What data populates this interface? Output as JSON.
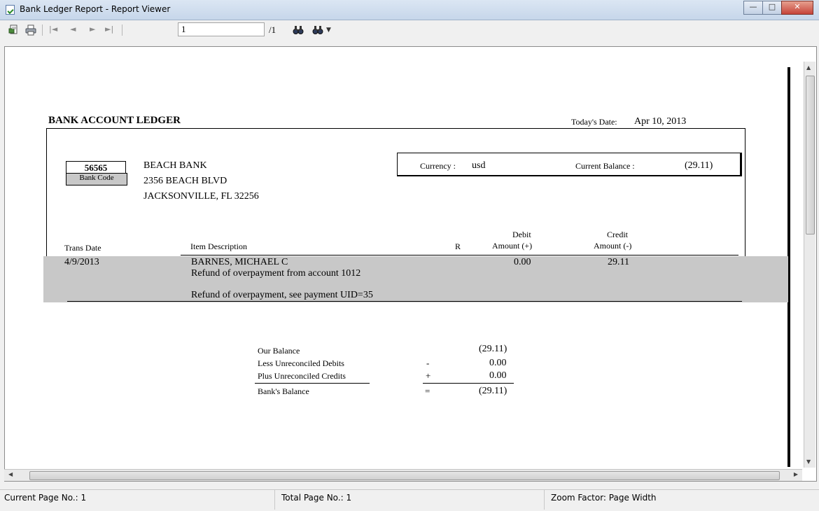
{
  "window": {
    "title": "Bank Ledger Report - Report Viewer"
  },
  "toolbar": {
    "page_value": "1",
    "page_total": "/1"
  },
  "report": {
    "heading": "BANK ACCOUNT LEDGER",
    "todays_date_label": "Today's Date:",
    "todays_date_value": "Apr 10, 2013",
    "bank_code_value": "56565",
    "bank_code_label": "Bank Code",
    "bank_name": "BEACH BANK",
    "bank_address1": "2356 BEACH BLVD",
    "bank_address2": "JACKSONVILLE, FL 32256",
    "currency_label": "Currency :",
    "currency_value": "usd",
    "current_balance_label": "Current Balance :",
    "current_balance_value": "(29.11)",
    "columns": {
      "trans_date": "Trans Date",
      "item_description": "Item Description",
      "r": "R",
      "debit_line1": "Debit",
      "debit_line2": "Amount (+)",
      "credit_line1": "Credit",
      "credit_line2": "Amount (-)"
    },
    "rows": [
      {
        "date": "4/9/2013",
        "name": "BARNES, MICHAEL C",
        "desc1": "Refund of overpayment from account 1012",
        "desc2": "Refund of overpayment, see payment UID=35",
        "debit": "0.00",
        "credit": "29.11"
      }
    ],
    "summary": {
      "our_balance_label": "Our Balance",
      "our_balance_value": "(29.11)",
      "less_label": "Less Unreconciled Debits",
      "less_op": "-",
      "less_value": "0.00",
      "plus_label": "Plus Unreconciled Credits",
      "plus_op": "+",
      "plus_value": "0.00",
      "bank_balance_label": "Bank's Balance",
      "bank_balance_op": "=",
      "bank_balance_value": "(29.11)"
    }
  },
  "status": {
    "current_page": "Current Page No.: 1",
    "total_page": "Total Page No.: 1",
    "zoom": "Zoom Factor: Page Width"
  },
  "colors": {
    "row_highlight": "#c8c8c8",
    "close_button": "#c6443a"
  }
}
